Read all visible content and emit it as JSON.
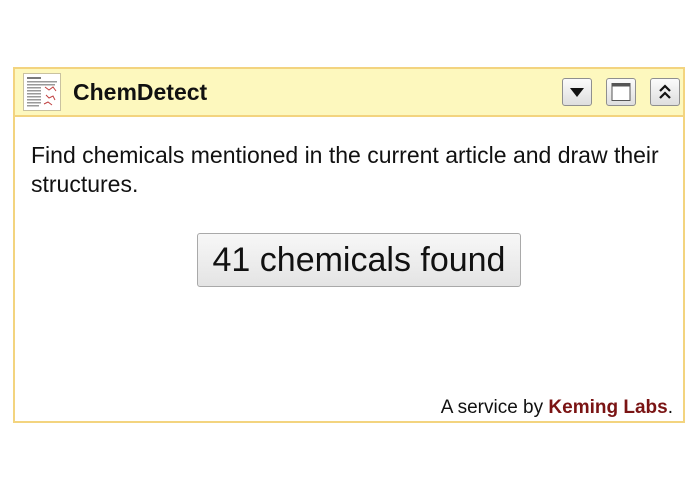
{
  "widget": {
    "title": "ChemDetect",
    "app_icon": "document-thumbnail-icon",
    "controls": {
      "menu_icon": "dropdown-arrow-icon",
      "maximize_icon": "maximize-window-icon",
      "collapse_icon": "double-chevron-up-icon"
    }
  },
  "main": {
    "description": "Find chemicals mentioned in the current article and draw their structures.",
    "result_button_label": "41 chemicals found"
  },
  "footer": {
    "prefix": "A service by ",
    "link_text": "Keming Labs",
    "suffix": "."
  },
  "colors": {
    "header_background": "#fdf8be",
    "border": "#f3d47f",
    "link": "#7a1414"
  }
}
